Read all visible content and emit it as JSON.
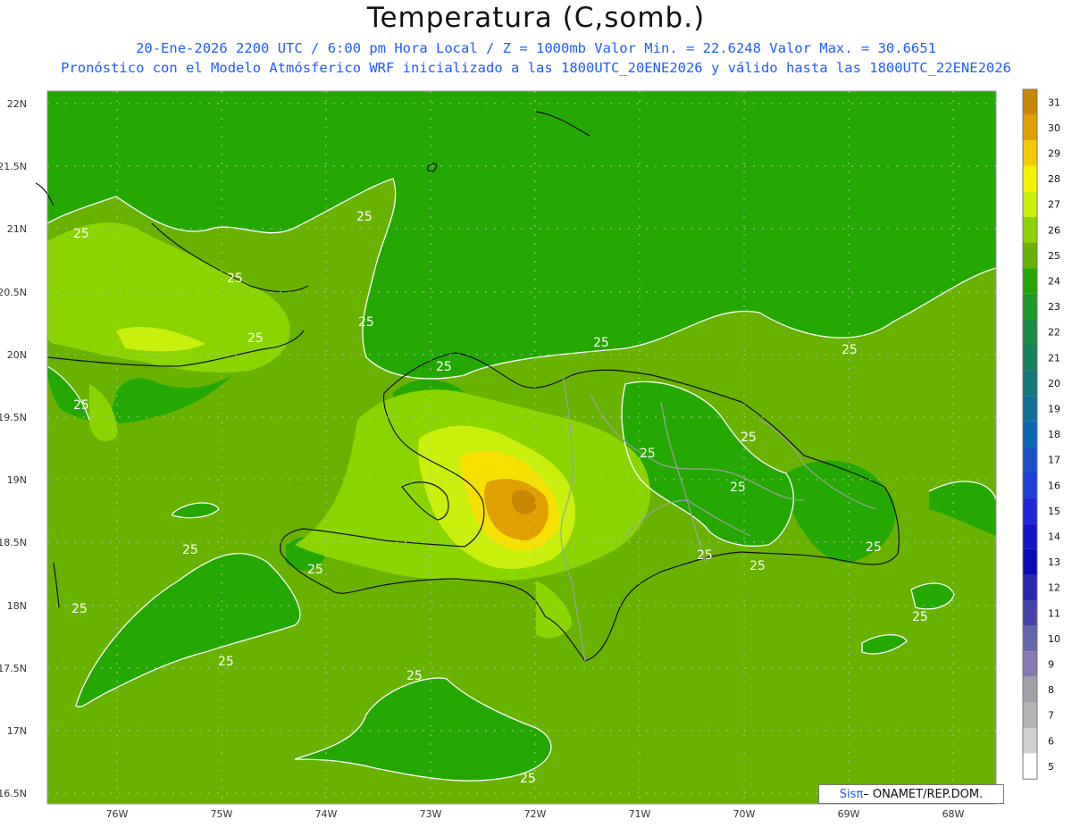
{
  "title": "Temperatura (C,somb.)",
  "line1": "20-Ene-2026  2200 UTC / 6:00 pm Hora Local / Z = 1000mb   Valor Min. = 22.6248  Valor Max. = 30.6651",
  "line2": "Pronóstico con el Modelo Atmósferico WRF inicializado a las 1800UTC_20ENE2026 y válido hasta las  1800UTC_22ENE2026",
  "lat_labels": [
    "22N",
    "21.5N",
    "21N",
    "20.5N",
    "20N",
    "19.5N",
    "19N",
    "18.5N",
    "18N",
    "17.5N",
    "17N",
    "16.5N"
  ],
  "lon_labels": [
    "76W",
    "75W",
    "74W",
    "73W",
    "72W",
    "71W",
    "70W",
    "69W",
    "68W"
  ],
  "contour_label": "25",
  "colorbar": {
    "values": [
      "31",
      "30",
      "29",
      "28",
      "27",
      "26",
      "25",
      "24",
      "23",
      "22",
      "21",
      "20",
      "19",
      "18",
      "17",
      "16",
      "15",
      "14",
      "13",
      "12",
      "11",
      "10",
      "9",
      "8",
      "7",
      "6",
      "5"
    ],
    "colors": [
      "#c88700",
      "#e0a000",
      "#f5c800",
      "#f7f000",
      "#c8f00c",
      "#8cd400",
      "#6ab200",
      "#24a800",
      "#1e9a28",
      "#1a8c46",
      "#168060",
      "#12787a",
      "#0e7094",
      "#0a68b0",
      "#1c52c8",
      "#1e3ed6",
      "#1c28d8",
      "#1416c8",
      "#0a0ab8",
      "#2828b0",
      "#4444a8",
      "#6666aa",
      "#8878b4",
      "#a0a0a8",
      "#b4b4b4",
      "#d0d0d0",
      "#ffffff"
    ]
  },
  "credit": {
    "brand": "Sisπ",
    "text": " – ONAMET/REP.DOM."
  }
}
